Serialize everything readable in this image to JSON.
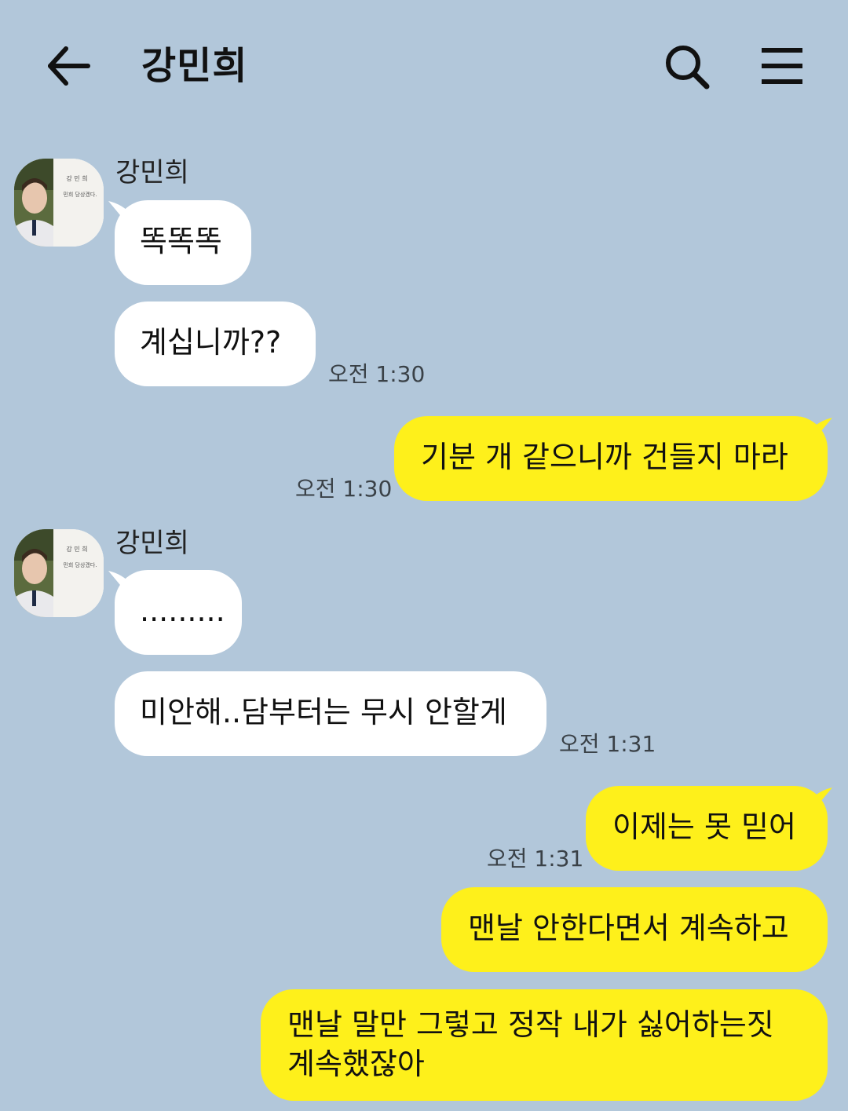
{
  "header": {
    "title": "강민희",
    "back_icon": "arrow-left-icon",
    "search_icon": "search-icon",
    "menu_icon": "hamburger-menu-icon"
  },
  "colors": {
    "background": "#b2c7da",
    "incoming_bubble": "#ffffff",
    "outgoing_bubble": "#fef01b"
  },
  "messages": [
    {
      "direction": "in",
      "sender": "강민희",
      "text": "똑똑똑",
      "time": ""
    },
    {
      "direction": "in",
      "sender": "",
      "text": "계십니까??",
      "time": "오전 1:30"
    },
    {
      "direction": "out",
      "text": "기분 개 같으니까 건들지 마라",
      "time": "오전 1:30"
    },
    {
      "direction": "in",
      "sender": "강민희",
      "text": ".........",
      "time": ""
    },
    {
      "direction": "in",
      "sender": "",
      "text": "미안해..담부터는 무시 안할게",
      "time": "오전 1:31"
    },
    {
      "direction": "out",
      "text": "이제는 못 믿어",
      "time": "오전 1:31"
    },
    {
      "direction": "out",
      "text": "맨날 안한다면서 계속하고",
      "time": ""
    },
    {
      "direction": "out",
      "text": "맨날 말만 그렇고 정작 내가 싫어하는짓 계속했잖아",
      "time": ""
    }
  ],
  "avatar": {
    "icon": "profile-photo-avatar",
    "photo_text_line1": "강 민 희",
    "photo_text_line2": "민희 당상겠다."
  }
}
